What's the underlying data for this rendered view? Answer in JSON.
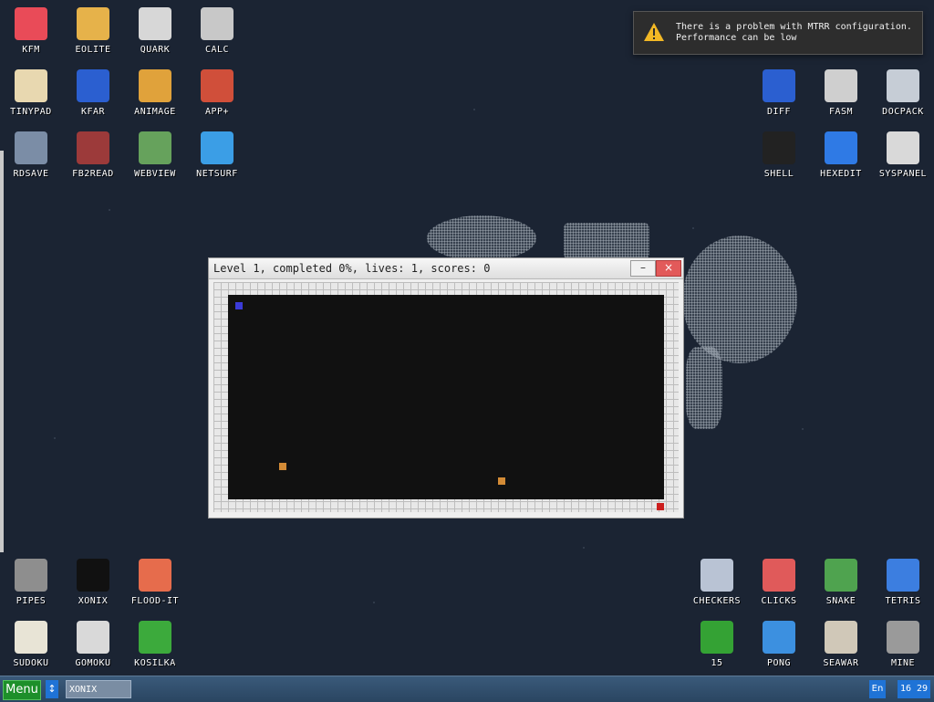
{
  "desktop": {
    "top_left_icons": [
      {
        "label": "KFM",
        "icon": "floppy-icon",
        "color": "#e94b58"
      },
      {
        "label": "EOLITE",
        "icon": "folder-icon",
        "color": "#e6b24a"
      },
      {
        "label": "QUARK",
        "icon": "notebook-icon",
        "color": "#d7d7d7"
      },
      {
        "label": "CALC",
        "icon": "calculator-icon",
        "color": "#c8c8c8"
      },
      {
        "label": "TINYPAD",
        "icon": "notepad-pencil-icon",
        "color": "#e8d8b0"
      },
      {
        "label": "KFAR",
        "icon": "dual-panel-icon",
        "color": "#2b5fd0"
      },
      {
        "label": "ANIMAGE",
        "icon": "pencil-ruler-icon",
        "color": "#e0a23b"
      },
      {
        "label": "APP+",
        "icon": "cube-icon",
        "color": "#d04f3a"
      },
      {
        "label": "RDSAVE",
        "icon": "printer-icon",
        "color": "#7b8da6"
      },
      {
        "label": "FB2READ",
        "icon": "book-icon",
        "color": "#9c3a3a"
      },
      {
        "label": "WEBVIEW",
        "icon": "picture-icon",
        "color": "#66a25c"
      },
      {
        "label": "NETSURF",
        "icon": "globe-icon",
        "color": "#3b9ee6"
      }
    ],
    "top_right_icons": [
      {
        "label": "DIFF",
        "icon": "dual-panel-icon",
        "color": "#2b5fd0"
      },
      {
        "label": "FASM",
        "icon": "hanging-icon",
        "color": "#cfcfcf"
      },
      {
        "label": "DOCPACK",
        "icon": "cabinet-icon",
        "color": "#c6cdd6"
      },
      {
        "label": "SHELL",
        "icon": "terminal-icon",
        "color": "#222222"
      },
      {
        "label": "HEXEDIT",
        "icon": "he-logo-icon",
        "color": "#2f7ae5"
      },
      {
        "label": "SYSPANEL",
        "icon": "sliders-icon",
        "color": "#d9d9d9"
      }
    ],
    "bottom_left_icons": [
      {
        "label": "PIPES",
        "icon": "pipe-icon",
        "color": "#8e8e8e"
      },
      {
        "label": "XONIX",
        "icon": "xonix-icon",
        "color": "#111111"
      },
      {
        "label": "FLOOD-IT",
        "icon": "mosaic-icon",
        "color": "#e66c4c"
      },
      {
        "label": "SUDOKU",
        "icon": "sudoku-icon",
        "color": "#e8e4d6"
      },
      {
        "label": "GOMOKU",
        "icon": "tictactoe-icon",
        "color": "#d9d9d9"
      },
      {
        "label": "KOSILKA",
        "icon": "lawnmower-icon",
        "color": "#3caa3c"
      }
    ],
    "bottom_right_icons": [
      {
        "label": "CHECKERS",
        "icon": "checkers-icon",
        "color": "#b9c3d4"
      },
      {
        "label": "CLICKS",
        "icon": "blocks-icon",
        "color": "#e05a5a"
      },
      {
        "label": "SNAKE",
        "icon": "snake-icon",
        "color": "#4fa34f"
      },
      {
        "label": "TETRIS",
        "icon": "tetris-icon",
        "color": "#3c7ee0"
      },
      {
        "label": "15",
        "icon": "grid-icon",
        "color": "#34a234"
      },
      {
        "label": "PONG",
        "icon": "paddle-ball-icon",
        "color": "#3c90e0"
      },
      {
        "label": "SEAWAR",
        "icon": "ship-icon",
        "color": "#d0c8b8"
      },
      {
        "label": "MINE",
        "icon": "mine-icon",
        "color": "#9a9a9a"
      }
    ]
  },
  "notification": {
    "icon": "warning-icon",
    "line1": "There is a problem with MTRR configuration.",
    "line2": "Performance can be low"
  },
  "game_window": {
    "title": "Level 1, completed 0%, lives: 1, scores: 0",
    "minimize_label": "–",
    "close_label": "×",
    "colors": {
      "sea": "#111111",
      "land": "#e8e8e8",
      "player": "#3b3bd8",
      "ball": "#d38b36",
      "land_enemy": "#cc1f1f"
    }
  },
  "taskbar": {
    "menu_label": "Menu",
    "switch_label": "↕",
    "active_app": "XONIX",
    "lang": "En",
    "clock": "16 29"
  }
}
